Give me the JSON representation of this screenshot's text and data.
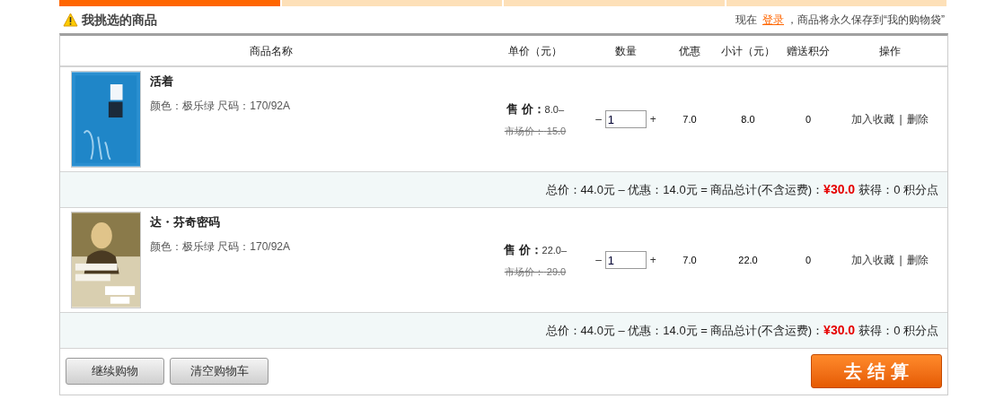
{
  "steps": [
    {
      "selected": true
    },
    {
      "selected": false
    },
    {
      "selected": false
    },
    {
      "selected": false
    }
  ],
  "header": {
    "title": "我挑选的商品",
    "notice_before": "现在 ",
    "login_link": "登录",
    "notice_after": "，商品将永久保存到“我的购物袋”"
  },
  "table": {
    "columns": [
      "商品名称",
      "单价（元）",
      "数量",
      "优惠",
      "小计（元）",
      "赠送积分",
      "操作"
    ],
    "items": [
      {
        "name": "活着",
        "attrs": "颜色：极乐绿 尺码：170/92A",
        "sale_label": "售 价：",
        "sale_price": "8.0–",
        "market_label": "市场价：",
        "market_price": "15.0",
        "quantity": "1",
        "minus": "–",
        "plus": "+",
        "discount": "7.0",
        "subtotal": "8.0",
        "points": "0",
        "favorite": "加入收藏",
        "separator": "|",
        "delete": "删除",
        "summary": {
          "total": "总价：44.0元 – 优惠：14.0元 = 商品总计(不含运费)：",
          "amount": "¥30.0",
          "earn": "获得：0 积分点"
        }
      },
      {
        "name": "达・芬奇密码",
        "attrs": "颜色：极乐绿 尺码：170/92A",
        "sale_label": "售 价：",
        "sale_price": "22.0–",
        "market_label": "市场价：",
        "market_price": "29.0",
        "quantity": "1",
        "minus": "–",
        "plus": "+",
        "discount": "7.0",
        "subtotal": "22.0",
        "points": "0",
        "favorite": "加入收藏",
        "separator": "|",
        "delete": "删除",
        "summary": {
          "total": "总价：44.0元 – 优惠：14.0元 = 商品总计(不含运费)：",
          "amount": "¥30.0",
          "earn": "获得：0 积分点"
        }
      }
    ]
  },
  "buttons": {
    "continue": "继续购物",
    "clear": "清空购物车",
    "checkout": "去 结 算"
  }
}
